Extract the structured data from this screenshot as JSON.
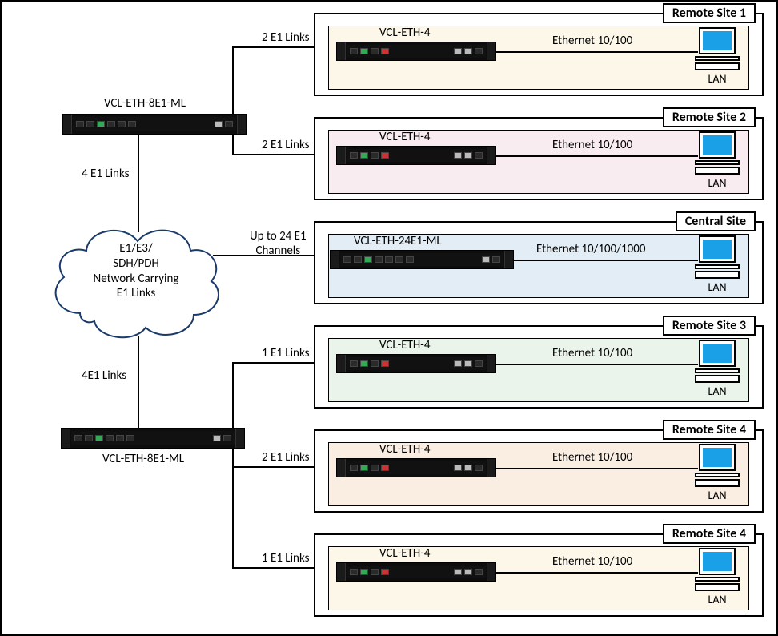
{
  "cloud": {
    "lines": [
      "E1/E3/",
      "SDH/PDH",
      "Network Carrying",
      "E1 Links"
    ]
  },
  "hubs": {
    "top_label": "VCL-ETH-8E1-ML",
    "bottom_label": "VCL-ETH-8E1-ML",
    "link_top": "4 E1 Links",
    "link_bottom": "4E1 Links"
  },
  "central": {
    "title": "Central Site",
    "device": "VCL-ETH-24E1-ML",
    "eth": "Ethernet 10/100/1000",
    "lan": "LAN",
    "link": "Up to 24 E1\nChannels",
    "bg": "#e3edf5"
  },
  "remotes": [
    {
      "title": "Remote Site 1",
      "device": "VCL-ETH-4",
      "eth": "Ethernet 10/100",
      "lan": "LAN",
      "link": "2 E1 Links",
      "bg": "#fcf7e8"
    },
    {
      "title": "Remote Site 2",
      "device": "VCL-ETH-4",
      "eth": "Ethernet 10/100",
      "lan": "LAN",
      "link": "2 E1 Links",
      "bg": "#f9ecf0"
    },
    {
      "title": "Remote Site 3",
      "device": "VCL-ETH-4",
      "eth": "Ethernet 10/100",
      "lan": "LAN",
      "link": "1 E1 Links",
      "bg": "#eaf4ea"
    },
    {
      "title": "Remote Site 4",
      "device": "VCL-ETH-4",
      "eth": "Ethernet 10/100",
      "lan": "LAN",
      "link": "2 E1 Links",
      "bg": "#faeee2"
    },
    {
      "title": "Remote Site 4",
      "device": "VCL-ETH-4",
      "eth": "Ethernet 10/100",
      "lan": "LAN",
      "link": "1 E1 Links",
      "bg": "#fcf7e8"
    }
  ]
}
